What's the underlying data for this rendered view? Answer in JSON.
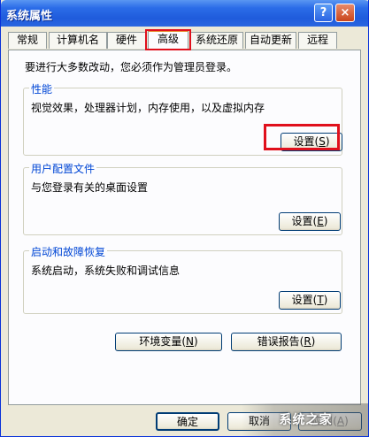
{
  "window": {
    "title": "系统属性"
  },
  "titlebar": {
    "help_label": "?",
    "close_label": "×"
  },
  "tabs": [
    {
      "label": "常规"
    },
    {
      "label": "计算机名"
    },
    {
      "label": "硬件"
    },
    {
      "label": "高级",
      "active": true
    },
    {
      "label": "系统还原"
    },
    {
      "label": "自动更新"
    },
    {
      "label": "远程"
    }
  ],
  "panel": {
    "intro": "要进行大多数改动，您必须作为管理员登录。",
    "performance": {
      "title": "性能",
      "desc": "视觉效果，处理器计划，内存使用，以及虚拟内存",
      "button": {
        "text": "设置",
        "key": "S"
      }
    },
    "user_profiles": {
      "title": "用户配置文件",
      "desc": "与您登录有关的桌面设置",
      "button": {
        "text": "设置",
        "key": "E"
      }
    },
    "startup": {
      "title": "启动和故障恢复",
      "desc": "系统启动，系统失败和调试信息",
      "button": {
        "text": "设置",
        "key": "T"
      }
    },
    "env_vars": {
      "text": "环境变量",
      "key": "N"
    },
    "error_report": {
      "text": "错误报告",
      "key": "R"
    }
  },
  "footer": {
    "ok": "确定",
    "cancel": "取消",
    "apply": {
      "text": "应用",
      "key": "A"
    }
  },
  "watermark": "系统之家",
  "colors": {
    "highlight": "#e0101c",
    "titlebar": "#1f5bdc",
    "group_title": "#0046d5"
  }
}
